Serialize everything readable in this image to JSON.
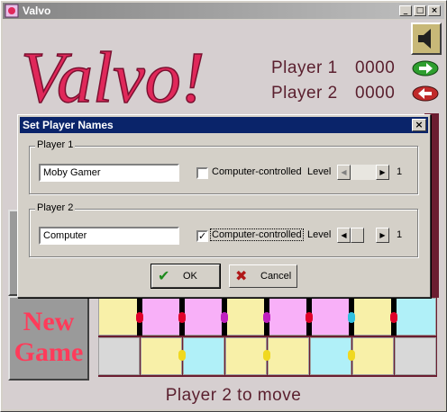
{
  "window": {
    "title": "Valvo",
    "controls": [
      "_",
      "□",
      "×"
    ]
  },
  "logo": {
    "text": "Valvo!",
    "color": "#e0285a"
  },
  "scores": [
    {
      "label": "Player 1",
      "score": "0000",
      "arrow_color": "#2e9e2e"
    },
    {
      "label": "Player 2",
      "score": "0000",
      "arrow_color": "#c02a2a"
    }
  ],
  "icons": {
    "sound": "speaker-icon",
    "p1_arrow": "right-arrow-icon",
    "p2_arrow": "left-arrow-icon",
    "ok": "check-icon",
    "cancel": "x-icon"
  },
  "new_game": {
    "line1": "New",
    "line2": "Game"
  },
  "status": "Player 2 to move",
  "dialog": {
    "title": "Set Player Names",
    "players": [
      {
        "group": "Player 1",
        "name": "Moby Gamer",
        "cc_label": "Computer-controlled",
        "cc_checked": false,
        "level_label": "Level",
        "level": "1"
      },
      {
        "group": "Player 2",
        "name": "Computer",
        "cc_label": "Computer-controlled",
        "cc_checked": true,
        "level_label": "Level",
        "level": "1"
      }
    ],
    "ok": "OK",
    "cancel": "Cancel"
  },
  "board": {
    "row1": [
      "#f8f0a8",
      "#f8b0f8",
      "#f8b0f8",
      "#f8f0a8",
      "#f8b0f8",
      "#f8b0f8",
      "#f8f0a8",
      "#b0f0f8"
    ],
    "row2": [
      "#d8d8d8",
      "#f8f0a8",
      "#b0f0f8",
      "#f8f0a8",
      "#f8f0a8",
      "#b0f0f8",
      "#f8f0a8",
      "#d8d8d8"
    ],
    "pegs_row1": [
      "#e0002a",
      "#e0002a",
      "#c020c0",
      "#c020c0",
      "#e0002a",
      "#30c0e0",
      "#e0002a"
    ],
    "pegs_row2": [
      "#f0d820",
      "#f0d820",
      "#f0d820",
      "#f0d820",
      "#f0d820",
      "#f0d820",
      "#f0d820"
    ]
  }
}
